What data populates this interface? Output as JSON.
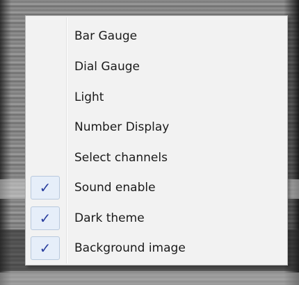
{
  "menu": {
    "items": [
      {
        "label": "Bar Gauge",
        "checked": false
      },
      {
        "label": "Dial Gauge",
        "checked": false
      },
      {
        "label": "Light",
        "checked": false
      },
      {
        "label": "Number Display",
        "checked": false
      },
      {
        "label": "Select channels",
        "checked": false
      },
      {
        "label": "Sound enable",
        "checked": true
      },
      {
        "label": "Dark theme",
        "checked": true
      },
      {
        "label": "Background image",
        "checked": true
      }
    ],
    "check_glyph": "✓",
    "colors": {
      "menu_background": "#f2f2f2",
      "check_color": "#2a3f9f",
      "check_box_fill": "#e6eef9"
    }
  }
}
